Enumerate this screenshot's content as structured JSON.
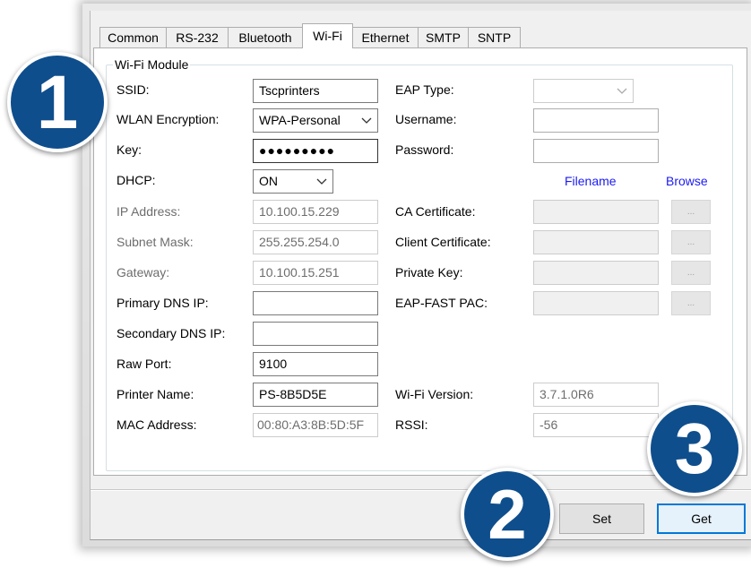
{
  "tabs": [
    {
      "label": "Common"
    },
    {
      "label": "RS-232"
    },
    {
      "label": "Bluetooth"
    },
    {
      "label": "Wi-Fi"
    },
    {
      "label": "Ethernet"
    },
    {
      "label": "SMTP"
    },
    {
      "label": "SNTP"
    }
  ],
  "group_title": "Wi-Fi Module",
  "left": {
    "ssid": {
      "label": "SSID:",
      "value": "Tscprinters"
    },
    "encryption": {
      "label": "WLAN Encryption:",
      "value": "WPA-Personal"
    },
    "key": {
      "label": "Key:",
      "value": "●●●●●●●●●"
    },
    "dhcp": {
      "label": "DHCP:",
      "value": "ON"
    },
    "ip": {
      "label": "IP Address:",
      "value": "10.100.15.229"
    },
    "subnet": {
      "label": "Subnet Mask:",
      "value": "255.255.254.0"
    },
    "gateway": {
      "label": "Gateway:",
      "value": "10.100.15.251"
    },
    "dns1": {
      "label": "Primary DNS IP:",
      "value": ""
    },
    "dns2": {
      "label": "Secondary DNS IP:",
      "value": ""
    },
    "raw_port": {
      "label": "Raw Port:",
      "value": "9100"
    },
    "printer_name": {
      "label": "Printer Name:",
      "value": "PS-8B5D5E"
    },
    "mac": {
      "label": "MAC Address:",
      "value": "00:80:A3:8B:5D:5F"
    }
  },
  "right": {
    "eap_type": {
      "label": "EAP Type:",
      "value": ""
    },
    "username": {
      "label": "Username:",
      "value": ""
    },
    "password": {
      "label": "Password:",
      "value": ""
    },
    "filename_header": "Filename",
    "browse_header": "Browse",
    "ca_cert": {
      "label": "CA Certificate:",
      "value": ""
    },
    "client_cert": {
      "label": "Client Certificate:",
      "value": ""
    },
    "private_key": {
      "label": "Private Key:",
      "value": ""
    },
    "eap_fast": {
      "label": "EAP-FAST PAC:",
      "value": ""
    },
    "browse_label": "...",
    "wifi_version": {
      "label": "Wi-Fi Version:",
      "value": "3.7.1.0R6"
    },
    "rssi": {
      "label": "RSSI:",
      "value": "-56"
    }
  },
  "buttons": {
    "set": "Set",
    "get": "Get"
  },
  "badges": {
    "one": "1",
    "two": "2",
    "three": "3"
  },
  "colors": {
    "badge": "#0f4e8c",
    "link": "#1b1bf0",
    "focus": "#0078d7"
  }
}
